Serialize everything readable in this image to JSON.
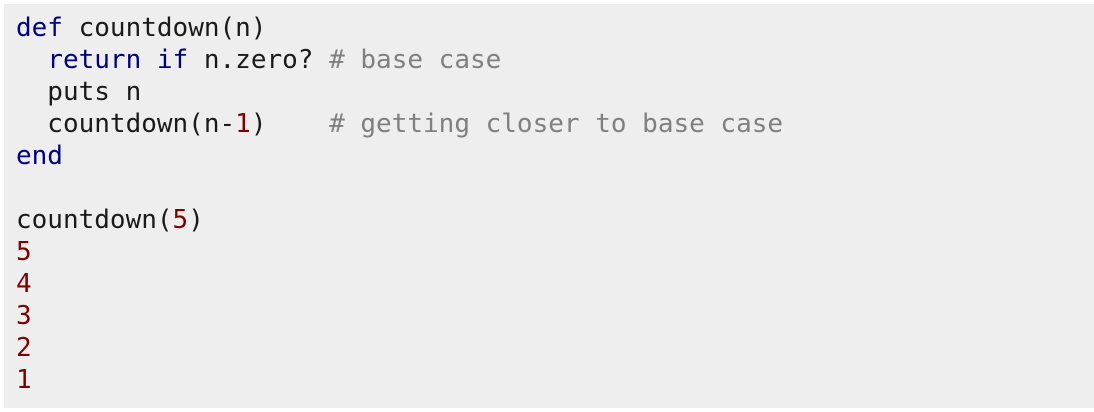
{
  "code": {
    "lines": [
      {
        "parts": [
          {
            "t": "def",
            "c": "kw"
          },
          {
            "t": " countdown(n)",
            "c": "plain"
          }
        ]
      },
      {
        "parts": [
          {
            "t": "  ",
            "c": "plain"
          },
          {
            "t": "return",
            "c": "kw"
          },
          {
            "t": " ",
            "c": "plain"
          },
          {
            "t": "if",
            "c": "kw"
          },
          {
            "t": " n.zero? ",
            "c": "plain"
          },
          {
            "t": "# base case",
            "c": "cm"
          }
        ]
      },
      {
        "parts": [
          {
            "t": "  puts n",
            "c": "plain"
          }
        ]
      },
      {
        "parts": [
          {
            "t": "  countdown(n-",
            "c": "plain"
          },
          {
            "t": "1",
            "c": "num"
          },
          {
            "t": ")    ",
            "c": "plain"
          },
          {
            "t": "# getting closer to base case",
            "c": "cm"
          }
        ]
      },
      {
        "parts": [
          {
            "t": "end",
            "c": "kw"
          }
        ]
      },
      {
        "parts": []
      },
      {
        "parts": [
          {
            "t": "countdown(",
            "c": "plain"
          },
          {
            "t": "5",
            "c": "num"
          },
          {
            "t": ")",
            "c": "plain"
          }
        ]
      },
      {
        "parts": [
          {
            "t": "5",
            "c": "num"
          }
        ]
      },
      {
        "parts": [
          {
            "t": "4",
            "c": "num"
          }
        ]
      },
      {
        "parts": [
          {
            "t": "3",
            "c": "num"
          }
        ]
      },
      {
        "parts": [
          {
            "t": "2",
            "c": "num"
          }
        ]
      },
      {
        "parts": [
          {
            "t": "1",
            "c": "num"
          }
        ]
      }
    ]
  },
  "colors": {
    "background": "#eeeeee",
    "keyword": "#000080",
    "number": "#800000",
    "comment": "#808080",
    "text": "#1a1a1a"
  }
}
